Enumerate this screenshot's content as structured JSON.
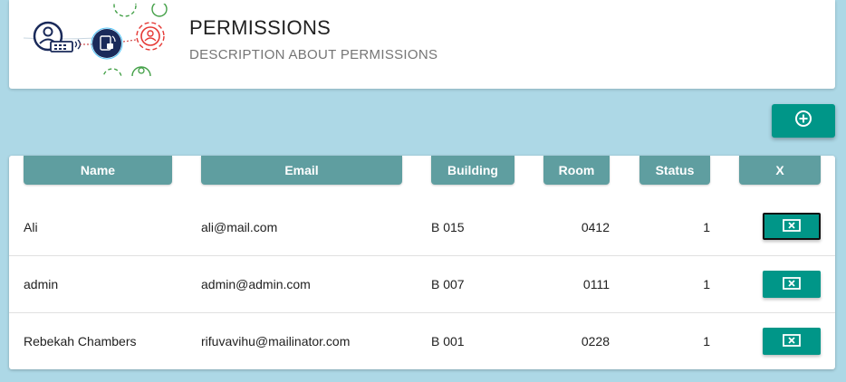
{
  "header": {
    "title": "PERMISSIONS",
    "description": "DESCRIPTION ABOUT PERMISSIONS"
  },
  "toolbar": {
    "add_icon": "add-circle-icon"
  },
  "table": {
    "columns": [
      "Name",
      "Email",
      "Building",
      "Room",
      "Status",
      "X"
    ],
    "rows": [
      {
        "name": "Ali",
        "email": "ali@mail.com",
        "building": "B 015",
        "room": "0412",
        "status": "1"
      },
      {
        "name": "admin",
        "email": "admin@admin.com",
        "building": "B 007",
        "room": "0111",
        "status": "1"
      },
      {
        "name": "Rebekah Chambers",
        "email": "rifuvavihu@mailinator.com",
        "building": "B 001",
        "room": "0228",
        "status": "1"
      }
    ],
    "delete_icon": "close-box-icon"
  },
  "colors": {
    "background": "#add8e6",
    "header_cell": "#5f9ea0",
    "accent": "#009688"
  }
}
